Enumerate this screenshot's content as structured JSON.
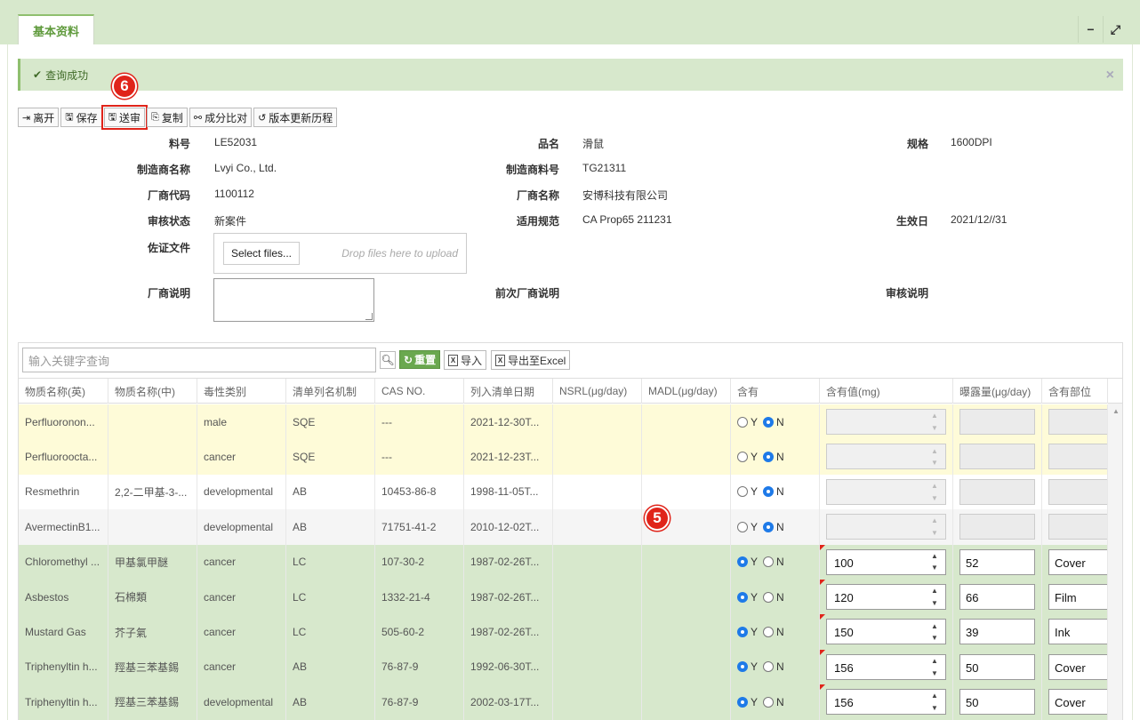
{
  "tab": {
    "title": "基本资料"
  },
  "window": {
    "minimize": "−",
    "maximize": "⤢"
  },
  "alert": {
    "text": "查询成功",
    "close": "×"
  },
  "toolbar": [
    {
      "label": "离开",
      "icon": "exit-icon"
    },
    {
      "label": "保存",
      "icon": "save-icon"
    },
    {
      "label": "送审",
      "icon": "submit-icon"
    },
    {
      "label": "复制",
      "icon": "copy-icon"
    },
    {
      "label": "成分比对",
      "icon": "compare-icon"
    },
    {
      "label": "版本更新历程",
      "icon": "history-icon"
    }
  ],
  "markers": {
    "m6": "6",
    "m5": "5"
  },
  "form": {
    "part_no_label": "料号",
    "part_no": "LE52031",
    "product_name_label": "品名",
    "product_name": "滑鼠",
    "spec_label": "规格",
    "spec": "1600DPI",
    "maker_name_label": "制造商名称",
    "maker_name": "Lvyi Co., Ltd.",
    "maker_part_label": "制造商料号",
    "maker_part": "TG21311",
    "vendor_code_label": "厂商代码",
    "vendor_code": "1100112",
    "vendor_name_label": "厂商名称",
    "vendor_name": "安博科技有限公司",
    "review_status_label": "审核状态",
    "review_status": "新案件",
    "regulation_label": "适用规范",
    "regulation": "CA Prop65 211231",
    "effective_date_label": "生效日",
    "effective_date": "2021/12//31",
    "evidence_label": "佐证文件",
    "select_files": "Select files...",
    "drop_hint": "Drop files here to upload",
    "vendor_note_label": "厂商说明",
    "prev_vendor_note_label": "前次厂商说明",
    "review_note_label": "审核说明"
  },
  "grid": {
    "search_placeholder": "输入关键字查询",
    "reset_label": "重置",
    "import_label": "导入",
    "export_label": "导出至Excel",
    "columns": [
      "物质名称(英)",
      "物质名称(中)",
      "毒性类别",
      "清单列名机制",
      "CAS NO.",
      "列入清单日期",
      "NSRL(μg/day)",
      "MADL(μg/day)",
      "含有",
      "含有值(mg)",
      "曝露量(μg/day)",
      "含有部位"
    ],
    "radio_y": "Y",
    "radio_n": "N",
    "rows": [
      {
        "en": "Perfluoronon...",
        "zh": "",
        "tox": "male",
        "mech": "SQE",
        "cas": "---",
        "date": "2021-12-30T...",
        "nsrl": "",
        "madl": "",
        "has": "N",
        "value": "",
        "exposure": "",
        "part": "",
        "style": "yellow"
      },
      {
        "en": "Perfluoroocta...",
        "zh": "",
        "tox": "cancer",
        "mech": "SQE",
        "cas": "---",
        "date": "2021-12-23T...",
        "nsrl": "",
        "madl": "",
        "has": "N",
        "value": "",
        "exposure": "",
        "part": "",
        "style": "yellow"
      },
      {
        "en": "Resmethrin",
        "zh": "2,2-二甲基-3-...",
        "tox": "developmental",
        "mech": "AB",
        "cas": "10453-86-8",
        "date": "1998-11-05T...",
        "nsrl": "",
        "madl": "",
        "has": "N",
        "value": "",
        "exposure": "",
        "part": "",
        "style": "white"
      },
      {
        "en": "AvermectinB1...",
        "zh": "",
        "tox": "developmental",
        "mech": "AB",
        "cas": "71751-41-2",
        "date": "2010-12-02T...",
        "nsrl": "",
        "madl": "",
        "has": "N",
        "value": "",
        "exposure": "",
        "part": "",
        "style": "grey"
      },
      {
        "en": "Chloromethyl ...",
        "zh": "甲基氯甲醚",
        "tox": "cancer",
        "mech": "LC",
        "cas": "107-30-2",
        "date": "1987-02-26T...",
        "nsrl": "",
        "madl": "",
        "has": "Y",
        "value": "100",
        "exposure": "52",
        "part": "Cover",
        "style": "green"
      },
      {
        "en": "Asbestos",
        "zh": "石棉類",
        "tox": "cancer",
        "mech": "LC",
        "cas": "1332-21-4",
        "date": "1987-02-26T...",
        "nsrl": "",
        "madl": "",
        "has": "Y",
        "value": "120",
        "exposure": "66",
        "part": "Film",
        "style": "green"
      },
      {
        "en": "Mustard Gas",
        "zh": "芥子氣",
        "tox": "cancer",
        "mech": "LC",
        "cas": "505-60-2",
        "date": "1987-02-26T...",
        "nsrl": "",
        "madl": "",
        "has": "Y",
        "value": "150",
        "exposure": "39",
        "part": "Ink",
        "style": "green"
      },
      {
        "en": "Triphenyltin h...",
        "zh": "羥基三苯基錫",
        "tox": "cancer",
        "mech": "AB",
        "cas": "76-87-9",
        "date": "1992-06-30T...",
        "nsrl": "",
        "madl": "",
        "has": "Y",
        "value": "156",
        "exposure": "50",
        "part": "Cover",
        "style": "green"
      },
      {
        "en": "Triphenyltin h...",
        "zh": "羥基三苯基錫",
        "tox": "developmental",
        "mech": "AB",
        "cas": "76-87-9",
        "date": "2002-03-17T...",
        "nsrl": "",
        "madl": "",
        "has": "Y",
        "value": "156",
        "exposure": "50",
        "part": "Cover",
        "style": "green"
      }
    ]
  }
}
